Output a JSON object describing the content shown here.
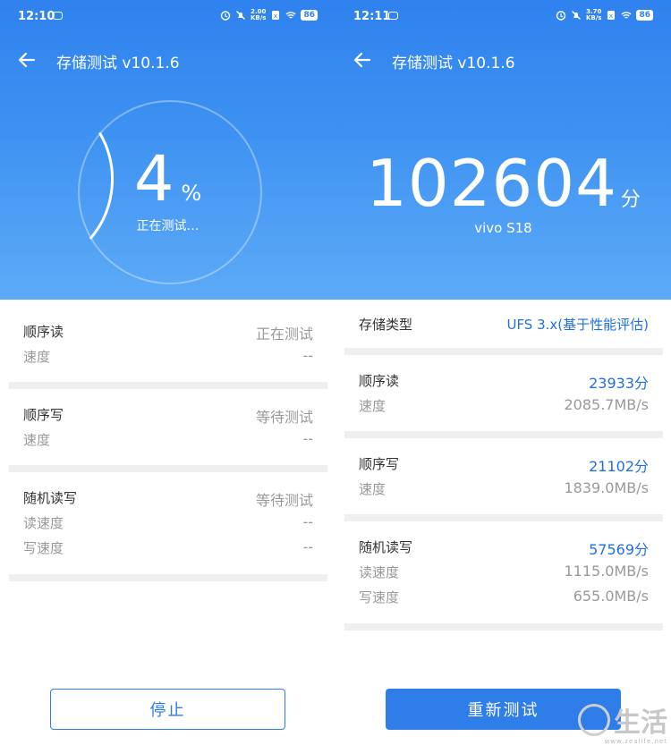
{
  "left": {
    "status": {
      "time": "12:10",
      "speed": "2.00\nKB/s",
      "battery": "86"
    },
    "title": "存储测试 v10.1.6",
    "progress": {
      "value": "4",
      "unit": "%",
      "fraction": 0.04,
      "status": "正在测试…"
    },
    "cards": {
      "seq_read": {
        "label": "顺序读",
        "value": "正在测试",
        "sub_label": "速度",
        "sub_value": "--"
      },
      "seq_write": {
        "label": "顺序写",
        "value": "等待测试",
        "sub_label": "速度",
        "sub_value": "--"
      },
      "random": {
        "label": "随机读写",
        "value": "等待测试",
        "read_label": "读速度",
        "read_value": "--",
        "write_label": "写速度",
        "write_value": "--"
      }
    },
    "button": "停止"
  },
  "right": {
    "status": {
      "time": "12:11",
      "speed": "3.70\nKB/s",
      "battery": "86"
    },
    "title": "存储测试 v10.1.6",
    "score": {
      "value": "102604",
      "unit": "分",
      "device": "vivo S18"
    },
    "storage_type": {
      "label": "存储类型",
      "value": "UFS 3.x(基于性能评估)"
    },
    "cards": {
      "seq_read": {
        "label": "顺序读",
        "score": "23933分",
        "sub_label": "速度",
        "sub_value": "2085.7MB/s"
      },
      "seq_write": {
        "label": "顺序写",
        "score": "21102分",
        "sub_label": "速度",
        "sub_value": "1839.0MB/s"
      },
      "random": {
        "label": "随机读写",
        "score": "57569分",
        "read_label": "读速度",
        "read_value": "1115.0MB/s",
        "write_label": "写速度",
        "write_value": "655.0MB/s"
      }
    },
    "button": "重新测试"
  },
  "watermark": {
    "text": "生活",
    "url": "www.zealife.net"
  },
  "colors": {
    "hero_top": "#2f82ee",
    "hero_bottom": "#5dabf7",
    "accent": "#2f7de8",
    "score_blue": "#1f6fdf"
  },
  "icons": {
    "back": "arrow-left-icon",
    "wifi": "wifi-icon",
    "mute": "bell-off-icon",
    "battery": "battery-icon"
  }
}
